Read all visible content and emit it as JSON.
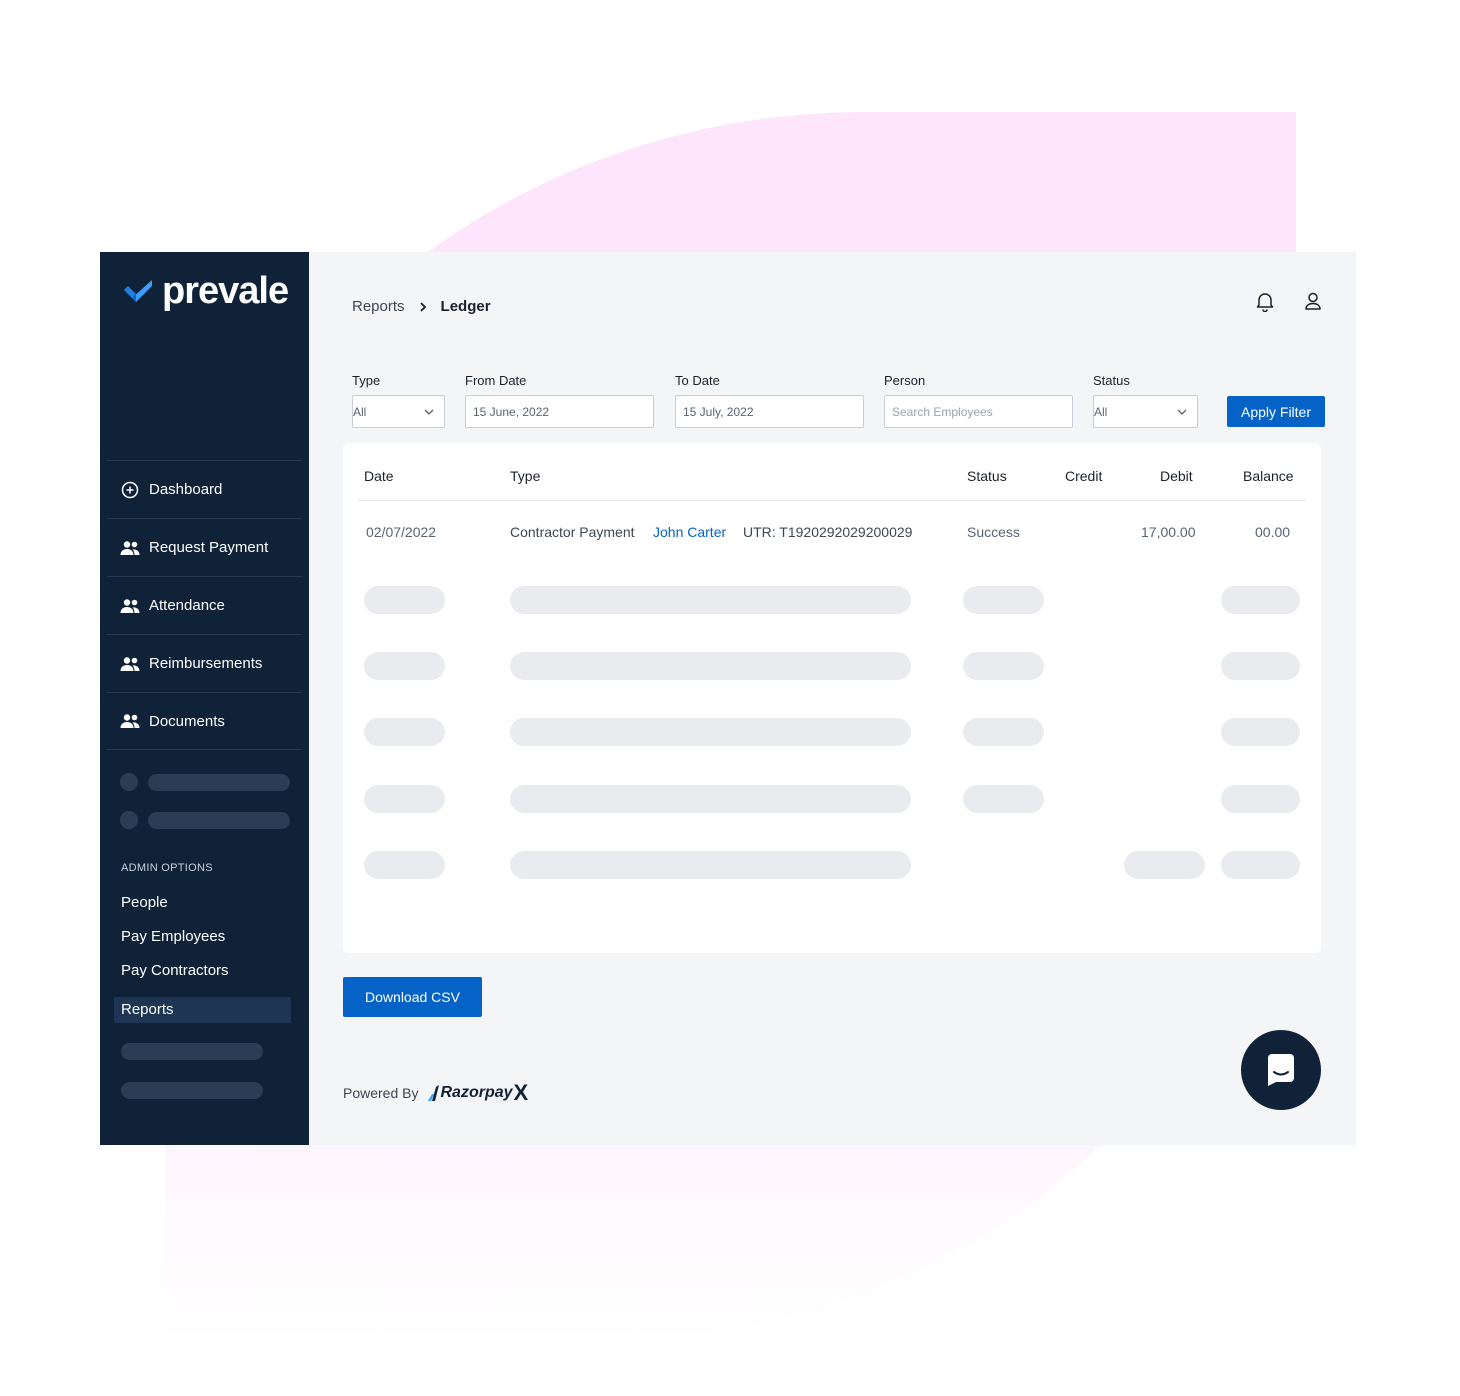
{
  "brand": {
    "name": "prevale",
    "accent": "#3aa0ff",
    "sidebar_bg": "#0f2238",
    "primary": "#0563c7"
  },
  "sidebar": {
    "items": [
      {
        "label": "Dashboard",
        "icon": "plus-circle-icon"
      },
      {
        "label": "Request Payment",
        "icon": "users-icon"
      },
      {
        "label": "Attendance",
        "icon": "users-icon"
      },
      {
        "label": "Reimbursements",
        "icon": "users-icon"
      },
      {
        "label": "Documents",
        "icon": "users-icon"
      }
    ],
    "admin_label": "ADMIN OPTIONS",
    "admin_items": [
      "People",
      "Pay Employees",
      "Pay Contractors",
      "Reports"
    ],
    "active_admin": "Reports"
  },
  "breadcrumb": {
    "parent": "Reports",
    "current": "Ledger"
  },
  "filters": {
    "type": {
      "label": "Type",
      "value": "All"
    },
    "from_date": {
      "label": "From Date",
      "value": "15 June, 2022"
    },
    "to_date": {
      "label": "To Date",
      "value": "15 July, 2022"
    },
    "person": {
      "label": "Person",
      "placeholder": "Search Employees"
    },
    "status": {
      "label": "Status",
      "value": "All"
    },
    "apply_label": "Apply Filter"
  },
  "table": {
    "headers": [
      "Date",
      "Type",
      "Status",
      "Credit",
      "Debit",
      "Balance"
    ],
    "rows": [
      {
        "date": "02/07/2022",
        "type": "Contractor Payment",
        "person": "John Carter",
        "utr": "UTR: T1920292029200029",
        "status": "Success",
        "credit": "",
        "debit": "17,00.00",
        "balance": "00.00"
      }
    ]
  },
  "download_label": "Download CSV",
  "powered_by": {
    "label": "Powered By",
    "brand": "Razorpay",
    "brand_suffix": "X"
  }
}
